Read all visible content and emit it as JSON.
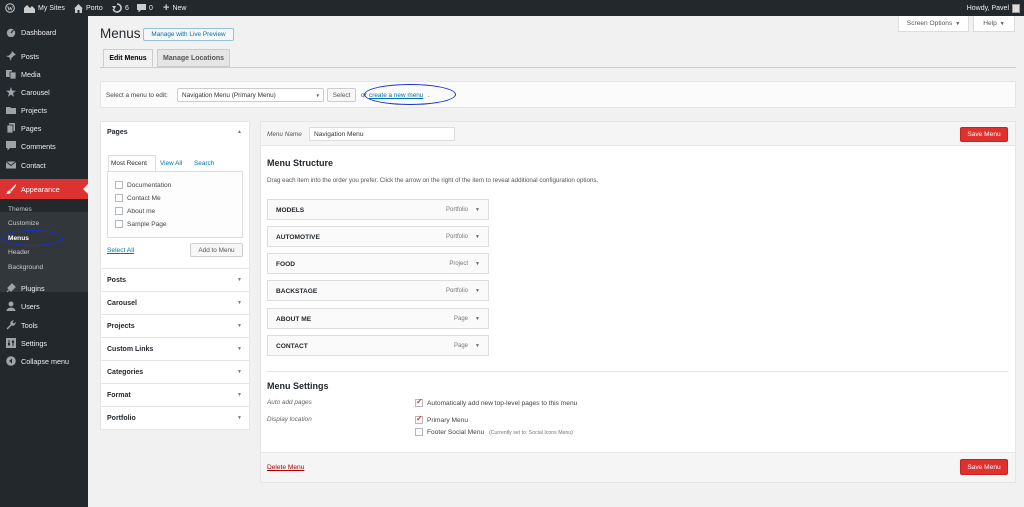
{
  "admin_bar": {
    "my_sites": "My Sites",
    "site_name": "Porto",
    "updates_count": "6",
    "comments_count": "0",
    "new_label": "New",
    "howdy": "Howdy, Pavel"
  },
  "sidebar": {
    "items": [
      {
        "label": "Dashboard",
        "icon": "dashboard-icon"
      },
      {
        "label": "Posts",
        "icon": "pin-icon"
      },
      {
        "label": "Media",
        "icon": "media-icon"
      },
      {
        "label": "Carousel",
        "icon": "star-icon"
      },
      {
        "label": "Projects",
        "icon": "folder-icon"
      },
      {
        "label": "Pages",
        "icon": "pages-icon"
      },
      {
        "label": "Comments",
        "icon": "comment-icon"
      },
      {
        "label": "Contact",
        "icon": "mail-icon"
      },
      {
        "label": "Appearance",
        "icon": "brush-icon"
      },
      {
        "label": "Plugins",
        "icon": "plugin-icon"
      },
      {
        "label": "Users",
        "icon": "users-icon"
      },
      {
        "label": "Tools",
        "icon": "wrench-icon"
      },
      {
        "label": "Settings",
        "icon": "settings-icon"
      },
      {
        "label": "Collapse menu",
        "icon": "collapse-icon"
      }
    ],
    "appearance_sub": [
      "Themes",
      "Customize",
      "Menus",
      "Header",
      "Background"
    ]
  },
  "screen_options": "Screen Options",
  "help": "Help",
  "page_title": "Menus",
  "live_preview": "Manage with Live Preview",
  "tabs": [
    "Edit Menus",
    "Manage Locations"
  ],
  "select_bar": {
    "label": "Select a menu to edit:",
    "selected": "Navigation Menu (Primary Menu)",
    "select_btn": "Select",
    "or": "or",
    "create_link": "create a new menu",
    "period": "."
  },
  "left_panel": {
    "pages_title": "Pages",
    "sub_tabs": [
      "Most Recent",
      "View All",
      "Search"
    ],
    "pages": [
      "Documentation",
      "Contact Me",
      "About me",
      "Sample Page"
    ],
    "select_all": "Select All",
    "add_to_menu": "Add to Menu",
    "sections": [
      "Posts",
      "Carousel",
      "Projects",
      "Custom Links",
      "Categories",
      "Format",
      "Portfolio"
    ]
  },
  "menu": {
    "name_label": "Menu Name",
    "name_value": "Navigation Menu",
    "save_label": "Save Menu",
    "structure_title": "Menu Structure",
    "structure_desc": "Drag each item into the order you prefer. Click the arrow on the right of the item to reveal additional configuration options.",
    "items": [
      {
        "title": "MODELS",
        "type": "Portfolio"
      },
      {
        "title": "AUTOMOTIVE",
        "type": "Portfolio"
      },
      {
        "title": "FOOD",
        "type": "Project"
      },
      {
        "title": "BACKSTAGE",
        "type": "Portfolio"
      },
      {
        "title": "ABOUT ME",
        "type": "Page"
      },
      {
        "title": "CONTACT",
        "type": "Page"
      }
    ],
    "settings_title": "Menu Settings",
    "auto_add_label": "Auto add pages",
    "auto_add_text": "Automatically add new top-level pages to this menu",
    "auto_add_checked": true,
    "display_location_label": "Display location",
    "loc_primary": "Primary Menu",
    "loc_primary_checked": true,
    "loc_footer": "Footer Social Menu",
    "loc_footer_note": "(Currently set to: Social Icons Menu)",
    "loc_footer_checked": false,
    "delete_label": "Delete Menu"
  },
  "colors": {
    "admin_bar": "#23282d",
    "accent_red": "#dc3232",
    "link_blue": "#0073aa",
    "annotation": "#1a2fd0"
  }
}
